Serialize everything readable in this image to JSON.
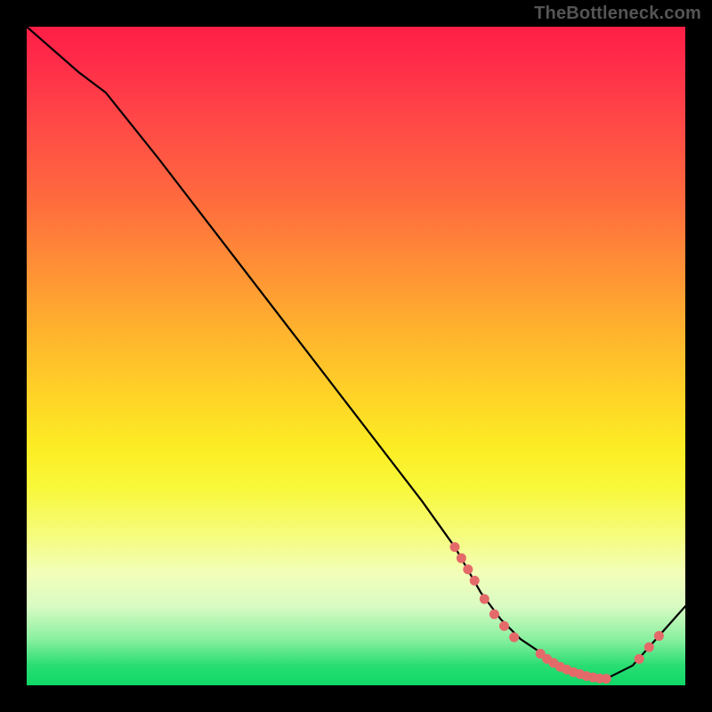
{
  "watermark": "TheBottleneck.com",
  "colors": {
    "page_bg": "#000000",
    "curve_stroke": "#000000",
    "marker_fill": "#e46a6a",
    "watermark_text": "#555555"
  },
  "chart_data": {
    "type": "line",
    "title": "",
    "xlabel": "",
    "ylabel": "",
    "xlim": [
      0,
      100
    ],
    "ylim": [
      0,
      100
    ],
    "grid": false,
    "legend": false,
    "series": [
      {
        "name": "bottleneck-curve",
        "x": [
          0,
          8,
          12,
          20,
          30,
          40,
          50,
          60,
          65,
          69,
          72,
          75,
          78,
          80,
          82,
          84,
          86,
          88,
          92,
          96,
          100
        ],
        "values": [
          100,
          93,
          90,
          80,
          67,
          54,
          41,
          28,
          21,
          14,
          10,
          7,
          5,
          3.5,
          2.5,
          1.8,
          1.2,
          1,
          3,
          7.5,
          12
        ]
      }
    ],
    "markers": [
      {
        "x": 65,
        "y": 21
      },
      {
        "x": 66,
        "y": 19.3
      },
      {
        "x": 67,
        "y": 17.6
      },
      {
        "x": 68,
        "y": 15.9
      },
      {
        "x": 69.5,
        "y": 13.1
      },
      {
        "x": 71,
        "y": 10.8
      },
      {
        "x": 72.5,
        "y": 9
      },
      {
        "x": 74,
        "y": 7.3
      },
      {
        "x": 78,
        "y": 4.8
      },
      {
        "x": 79,
        "y": 4
      },
      {
        "x": 80,
        "y": 3.4
      },
      {
        "x": 81,
        "y": 2.8
      },
      {
        "x": 82,
        "y": 2.4
      },
      {
        "x": 83,
        "y": 2
      },
      {
        "x": 84,
        "y": 1.7
      },
      {
        "x": 85,
        "y": 1.4
      },
      {
        "x": 86,
        "y": 1.2
      },
      {
        "x": 87,
        "y": 1.05
      },
      {
        "x": 88,
        "y": 1
      },
      {
        "x": 93,
        "y": 4
      },
      {
        "x": 94.5,
        "y": 5.8
      },
      {
        "x": 96,
        "y": 7.5
      }
    ]
  }
}
